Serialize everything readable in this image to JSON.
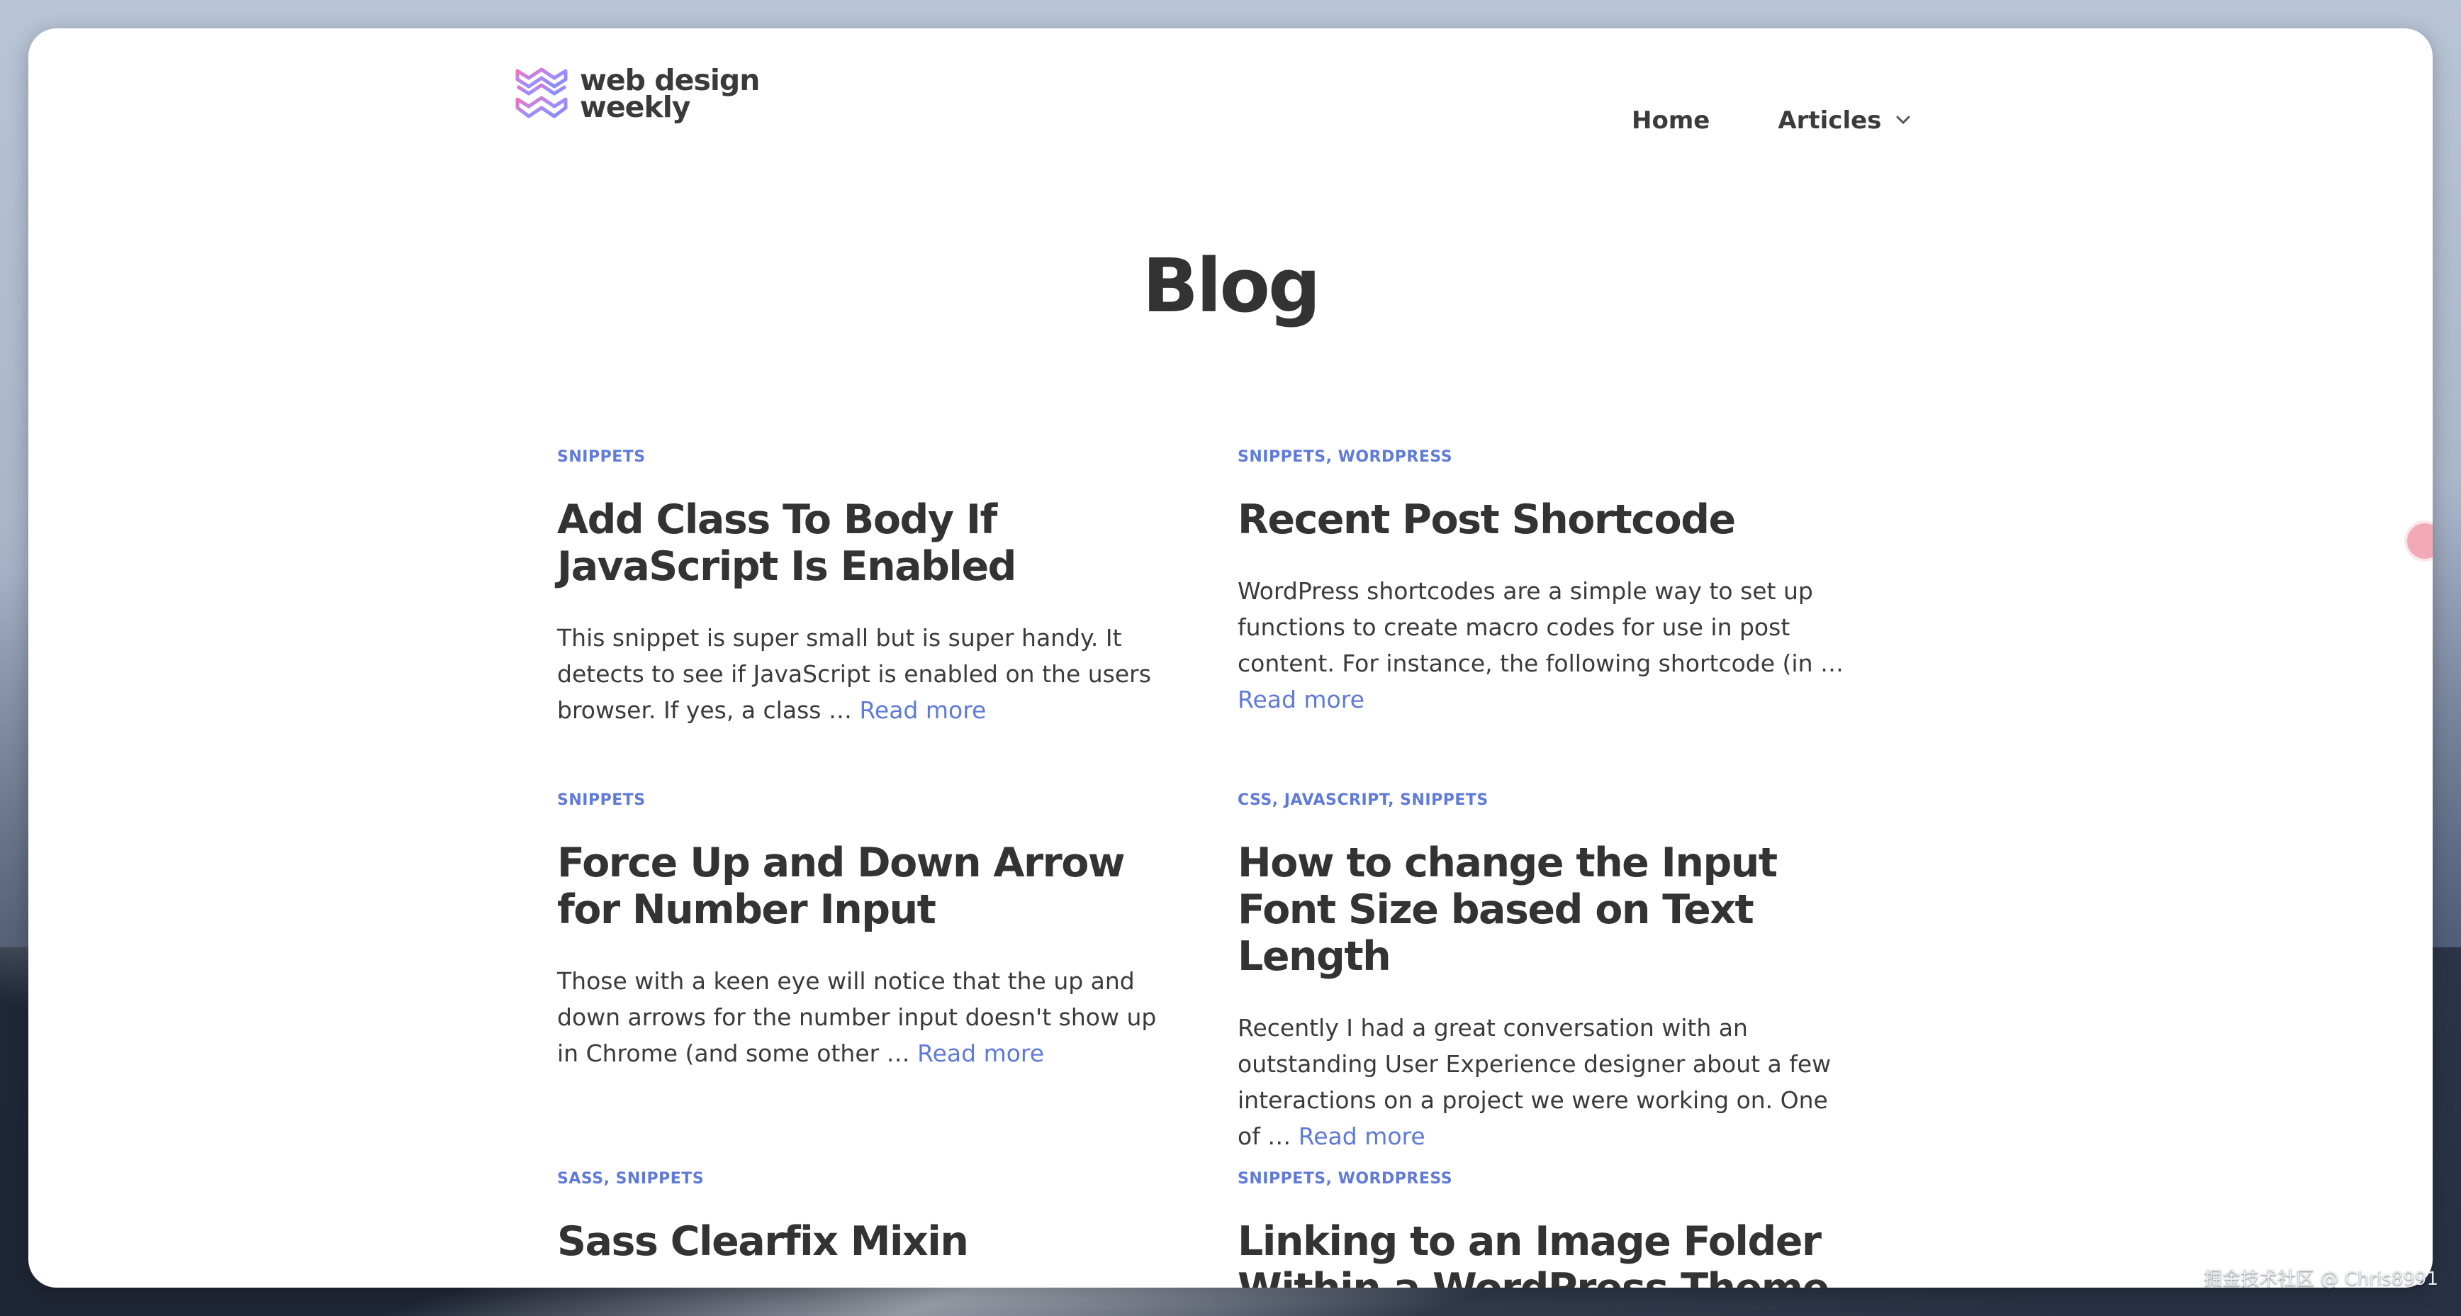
{
  "brand": {
    "logo_line1": "web design",
    "logo_line2": "weekly",
    "logo_icon": "wavy-chevrons-icon",
    "logo_colors": [
      "#f472b6",
      "#a78bfa",
      "#818cf8"
    ]
  },
  "nav": {
    "home": "Home",
    "articles": "Articles",
    "articles_icon": "chevron-down-icon"
  },
  "page": {
    "title": "Blog"
  },
  "colors": {
    "accent": "#5f7ad8",
    "heading": "#333333",
    "text": "#3b3b3b"
  },
  "posts": [
    {
      "categories": "SNIPPETS",
      "title": "Add Class To Body If JavaScript Is Enabled",
      "excerpt": "This snippet is super small but is super handy. It detects to see if JavaScript is enabled on the users browser. If yes, a class … ",
      "read_more": "Read more"
    },
    {
      "categories": "SNIPPETS, WORDPRESS",
      "title": "Recent Post Shortcode",
      "excerpt": "WordPress shortcodes are a simple way to set up functions to create macro codes for use in post content. For instance, the following shortcode (in … ",
      "read_more": "Read more"
    },
    {
      "categories": "SNIPPETS",
      "title": "Force Up and Down Arrow for Number Input",
      "excerpt": "Those with a keen eye will notice that the up and down arrows for the number input doesn't show up in Chrome (and some other … ",
      "read_more": "Read more"
    },
    {
      "categories": "CSS, JAVASCRIPT, SNIPPETS",
      "title": "How to change the Input Font Size based on Text Length",
      "excerpt": "Recently I had a great conversation with an outstanding User Experience designer about a few interactions on a project we were working on. One of … ",
      "read_more": "Read more"
    },
    {
      "categories": "SASS, SNIPPETS",
      "title": "Sass Clearfix Mixin"
    },
    {
      "categories": "SNIPPETS, WORDPRESS",
      "title": "Linking to an Image Folder Within a WordPress Theme"
    }
  ],
  "watermark": "掘金技术社区 @ Chris8991"
}
